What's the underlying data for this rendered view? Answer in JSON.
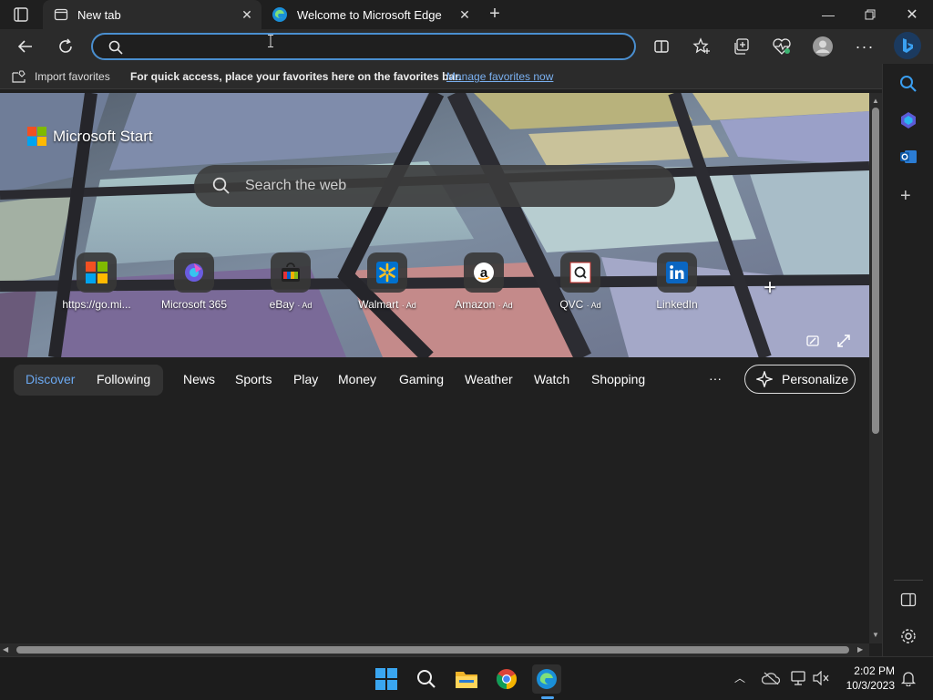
{
  "tabs": [
    {
      "label": "New tab",
      "active": true
    },
    {
      "label": "Welcome to Microsoft Edge",
      "active": false
    }
  ],
  "address_bar": {
    "value": "",
    "placeholder": ""
  },
  "favorites_bar": {
    "import_label": "Import favorites",
    "message": "For quick access, place your favorites here on the favorites bar.",
    "manage_link": "Manage favorites now"
  },
  "brand": {
    "name": "Microsoft Start"
  },
  "web_search": {
    "placeholder": "Search the web"
  },
  "quick_links": [
    {
      "label": "https://go.mi...",
      "ad": "",
      "icon": "microsoft-logo-icon"
    },
    {
      "label": "Microsoft 365",
      "ad": "",
      "icon": "microsoft-365-icon"
    },
    {
      "label": "eBay",
      "ad": "· Ad",
      "icon": "ebay-icon"
    },
    {
      "label": "Walmart",
      "ad": "· Ad",
      "icon": "walmart-icon"
    },
    {
      "label": "Amazon",
      "ad": "· Ad",
      "icon": "amazon-icon"
    },
    {
      "label": "QVC",
      "ad": "· Ad",
      "icon": "qvc-icon"
    },
    {
      "label": "LinkedIn",
      "ad": "",
      "icon": "linkedin-icon"
    }
  ],
  "feed_tabs": {
    "discover": "Discover",
    "following": "Following",
    "categories": [
      "News",
      "Sports",
      "Play",
      "Money",
      "Gaming",
      "Weather",
      "Watch",
      "Shopping"
    ],
    "more": "···",
    "personalize": "Personalize"
  },
  "taskbar": {
    "time": "2:02 PM",
    "date": "10/3/2023"
  },
  "colors": {
    "accent": "#4a8fd0",
    "link": "#7ab0f0",
    "discover_text": "#6ba8f0",
    "background": "#202020"
  }
}
